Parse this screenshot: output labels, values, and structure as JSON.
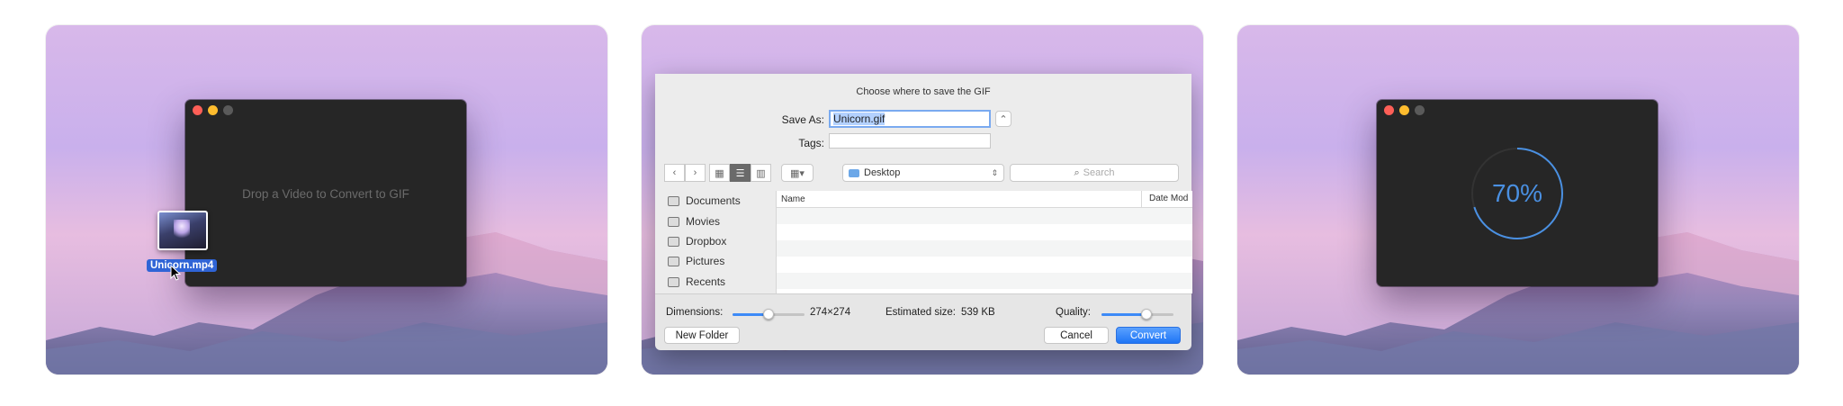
{
  "colors": {
    "accent": "#2f64d6",
    "progress": "#4a90e2",
    "window_bg": "#262626"
  },
  "panel1": {
    "drop_hint": "Drop a Video to Convert to GIF",
    "file_name": "Unicorn.mp4"
  },
  "panel2": {
    "title": "Choose where to save the GIF",
    "save_as_label": "Save As:",
    "save_as_value": "Unicorn.gif",
    "tags_label": "Tags:",
    "location": "Desktop",
    "search_placeholder": "Search",
    "sidebar": [
      {
        "label": "Documents",
        "icon": "documents-icon"
      },
      {
        "label": "Movies",
        "icon": "movies-icon"
      },
      {
        "label": "Dropbox",
        "icon": "dropbox-icon"
      },
      {
        "label": "Pictures",
        "icon": "pictures-icon"
      },
      {
        "label": "Recents",
        "icon": "recents-icon"
      }
    ],
    "columns": {
      "name": "Name",
      "date": "Date Mod"
    },
    "dimensions_label": "Dimensions:",
    "dimensions_value": "274×274",
    "dimensions_slider": 0.5,
    "estimated_label": "Estimated size:",
    "estimated_value": "539 KB",
    "quality_label": "Quality:",
    "quality_slider": 0.62,
    "new_folder": "New Folder",
    "cancel": "Cancel",
    "convert": "Convert"
  },
  "panel3": {
    "progress_text": "70%",
    "progress": 0.7
  }
}
